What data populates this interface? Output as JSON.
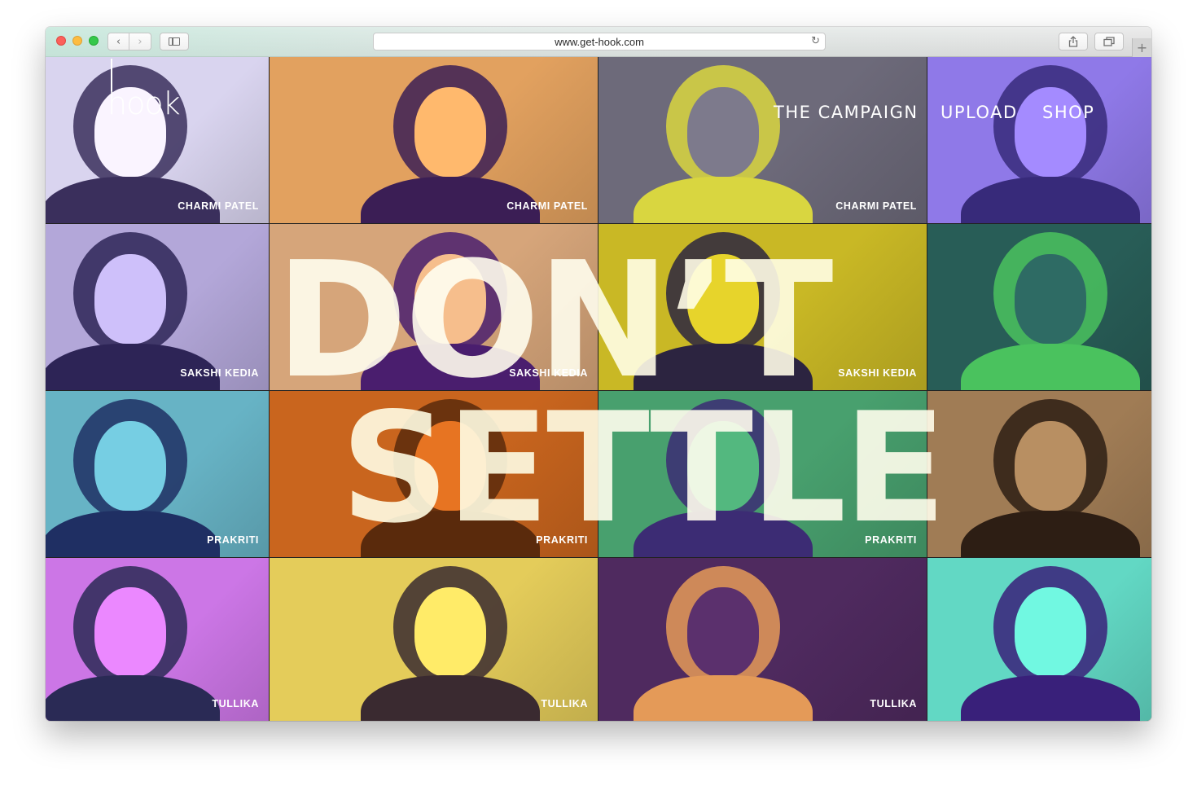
{
  "browser": {
    "url": "www.get-hook.com",
    "back_icon": "chevron-left-icon",
    "forward_icon": "chevron-right-icon",
    "reload_icon": "reload-icon",
    "share_icon": "share-icon",
    "tabs_icon": "tabs-icon",
    "new_tab_label": "+"
  },
  "site": {
    "logo": "hook",
    "nav": {
      "campaign": "THE CAMPAIGN",
      "upload": "UPLOAD",
      "shop": "SHOP"
    },
    "headline_line1": "DON’T",
    "headline_line2": "SETTLE"
  },
  "grid": {
    "rows": [
      [
        {
          "caption": "CHARMI PATEL",
          "bg": "#d9d4ef",
          "fg": "#3a2f5c"
        },
        {
          "caption": "CHARMI PATEL",
          "bg": "#e2a15f",
          "fg": "#3b1e55"
        },
        {
          "caption": "CHARMI PATEL",
          "bg": "#6d6a7a",
          "fg": "#d9d640"
        },
        {
          "caption": "",
          "bg": "#8f79e8",
          "fg": "#372a7a"
        }
      ],
      [
        {
          "caption": "SAKSHI KEDIA",
          "bg": "#b3a7d9",
          "fg": "#2d2456"
        },
        {
          "caption": "SAKSHI KEDIA",
          "bg": "#d6a57a",
          "fg": "#4a1e6e"
        },
        {
          "caption": "SAKSHI KEDIA",
          "bg": "#c9b825",
          "fg": "#2c2440"
        },
        {
          "caption": "",
          "bg": "#285d57",
          "fg": "#4ac25e"
        }
      ],
      [
        {
          "caption": "PRAKRITI",
          "bg": "#67b3c5",
          "fg": "#1f2f63"
        },
        {
          "caption": "PRAKRITI",
          "bg": "#c9651e",
          "fg": "#5a2a0c"
        },
        {
          "caption": "PRAKRITI",
          "bg": "#48a06e",
          "fg": "#3c2c74"
        },
        {
          "caption": "",
          "bg": "#a07c55",
          "fg": "#2d1e14"
        }
      ],
      [
        {
          "caption": "TULLIKA",
          "bg": "#cc76e6",
          "fg": "#2a2a55"
        },
        {
          "caption": "TULLIKA",
          "bg": "#e4cc5a",
          "fg": "#3a2a30"
        },
        {
          "caption": "TULLIKA",
          "bg": "#4f2a5f",
          "fg": "#e49a58"
        },
        {
          "caption": "",
          "bg": "#62d8c4",
          "fg": "#39207a"
        }
      ]
    ]
  }
}
